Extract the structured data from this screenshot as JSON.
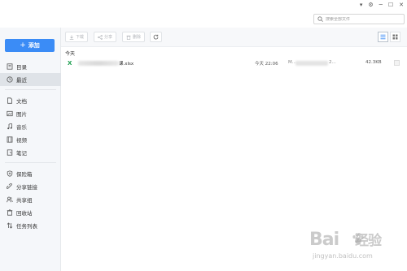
{
  "window": {
    "controls": [
      "▾",
      "⚙",
      "─",
      "☐",
      "✕"
    ]
  },
  "search": {
    "placeholder": "搜索全部文件"
  },
  "sidebar": {
    "add_label": "添加",
    "groups": [
      [
        {
          "label": "目录",
          "icon": "directory-icon"
        },
        {
          "label": "最近",
          "icon": "clock-icon",
          "active": true
        }
      ],
      [
        {
          "label": "文档",
          "icon": "document-icon"
        },
        {
          "label": "图片",
          "icon": "image-icon"
        },
        {
          "label": "音乐",
          "icon": "music-icon"
        },
        {
          "label": "视频",
          "icon": "video-icon"
        },
        {
          "label": "笔记",
          "icon": "note-icon"
        }
      ],
      [
        {
          "label": "保险箱",
          "icon": "shield-icon"
        },
        {
          "label": "分享链接",
          "icon": "link-icon"
        },
        {
          "label": "共享组",
          "icon": "group-icon"
        },
        {
          "label": "回收站",
          "icon": "trash-icon"
        },
        {
          "label": "任务列表",
          "icon": "transfer-icon"
        }
      ]
    ]
  },
  "toolbar": {
    "download_label": "下载",
    "share_label": "分享",
    "delete_label": "删除"
  },
  "content": {
    "section_title": "今天",
    "files": [
      {
        "name_visible": "课.xlsx",
        "time": "今天 22:06",
        "path_prefix": "M...",
        "path_suffix": "2...",
        "size": "42.3KB",
        "type_icon": "X"
      }
    ]
  },
  "watermark": {
    "brand": "Bai",
    "brand_cn": "经验",
    "url": "jingyan.baidu.com"
  }
}
